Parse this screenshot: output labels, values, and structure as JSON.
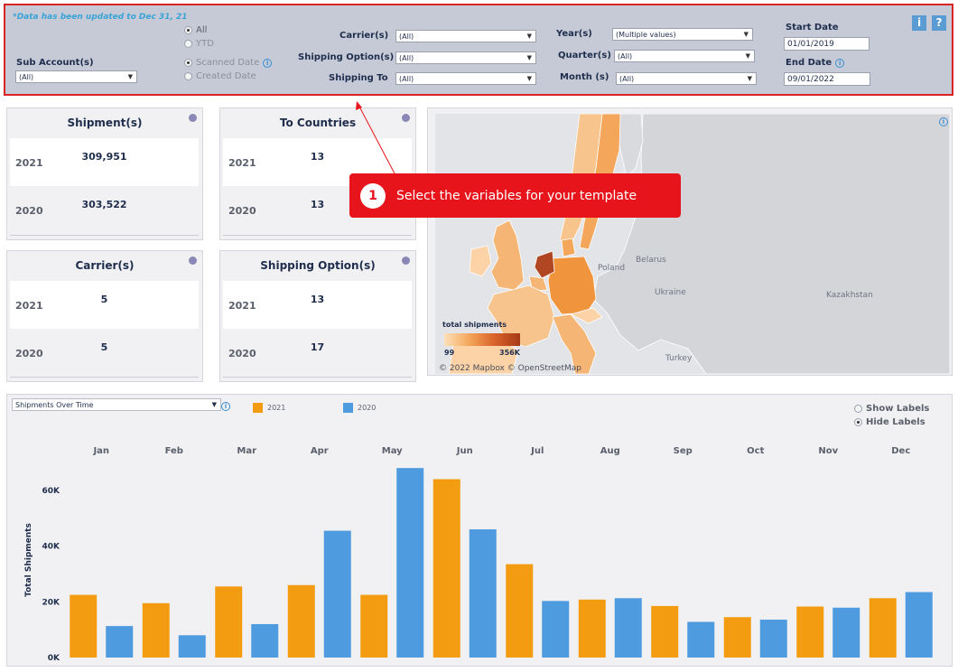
{
  "filters": {
    "updated_note": "*Data has been updated to Dec 31, 21",
    "sub_account_label": "Sub Account(s)",
    "sub_account_value": "(All)",
    "period_options": [
      {
        "label": "All",
        "selected": true,
        "muted": false
      },
      {
        "label": "YTD",
        "selected": false,
        "muted": true
      }
    ],
    "date_type_options": [
      {
        "label": "Scanned Date",
        "selected": true
      },
      {
        "label": "Created Date",
        "selected": false
      }
    ],
    "carriers_label": "Carrier(s)",
    "carriers_value": "(All)",
    "shipping_option_label": "Shipping Option(s)",
    "shipping_option_value": "(All)",
    "shipping_to_label": "Shipping To",
    "shipping_to_value": "(All)",
    "years_label": "Year(s)",
    "years_value": "(Multiple values)",
    "quarters_label": "Quarter(s)",
    "quarters_value": "(All)",
    "month_label": "Month (s)",
    "month_value": "(All)",
    "start_date_label": "Start Date",
    "start_date_value": "01/01/2019",
    "end_date_label": "End Date",
    "end_date_value": "09/01/2022",
    "info_button": "i",
    "help_button": "?"
  },
  "cards": [
    {
      "title": "Shipment(s)",
      "rows": [
        {
          "year": "2021",
          "value": "309,951"
        },
        {
          "year": "2020",
          "value": "303,522"
        }
      ]
    },
    {
      "title": "To Countries",
      "rows": [
        {
          "year": "2021",
          "value": "13"
        },
        {
          "year": "2020",
          "value": "13"
        }
      ]
    },
    {
      "title": "Carrier(s)",
      "rows": [
        {
          "year": "2021",
          "value": "5"
        },
        {
          "year": "2020",
          "value": "5"
        }
      ]
    },
    {
      "title": "Shipping Option(s)",
      "rows": [
        {
          "year": "2021",
          "value": "13"
        },
        {
          "year": "2020",
          "value": "17"
        }
      ]
    }
  ],
  "map": {
    "labels": {
      "poland": "Poland",
      "belarus": "Belarus",
      "ukraine": "Ukraine",
      "kazakhstan": "Kazakhstan",
      "turkey": "Turkey"
    },
    "legend_title": "total shipments",
    "legend_min": "99",
    "legend_max": "356K",
    "attribution": "© 2022 Mapbox  © OpenStreetMap"
  },
  "callout": {
    "number": "1",
    "text": "Select the variables for your template"
  },
  "chart_panel": {
    "selector_value": "Shipments Over Time",
    "show_labels": "Show Labels",
    "hide_labels": "Hide Labels",
    "label_mode": "hide"
  },
  "colors": {
    "series_2021": "#f39c12",
    "series_2020": "#4f9be0",
    "accent_red": "#e8141c"
  },
  "chart_data": {
    "type": "bar",
    "categories": [
      "Jan",
      "Feb",
      "Mar",
      "Apr",
      "May",
      "Jun",
      "Jul",
      "Aug",
      "Sep",
      "Oct",
      "Nov",
      "Dec"
    ],
    "series": [
      {
        "name": "2021",
        "values": [
          22500,
          19500,
          25500,
          26000,
          22500,
          64000,
          33500,
          20800,
          18500,
          14500,
          18300,
          21300
        ]
      },
      {
        "name": "2020",
        "values": [
          11300,
          8000,
          12000,
          45500,
          68000,
          46000,
          20300,
          21300,
          12800,
          13600,
          17900,
          23500
        ]
      }
    ],
    "ylabel": "Total Shipments",
    "yticks": [
      {
        "value": 0,
        "label": "0K"
      },
      {
        "value": 20000,
        "label": "20K"
      },
      {
        "value": 40000,
        "label": "40K"
      },
      {
        "value": 60000,
        "label": "60K"
      }
    ],
    "ylim": [
      0,
      70000
    ],
    "grid": false,
    "legend": "top-left"
  }
}
